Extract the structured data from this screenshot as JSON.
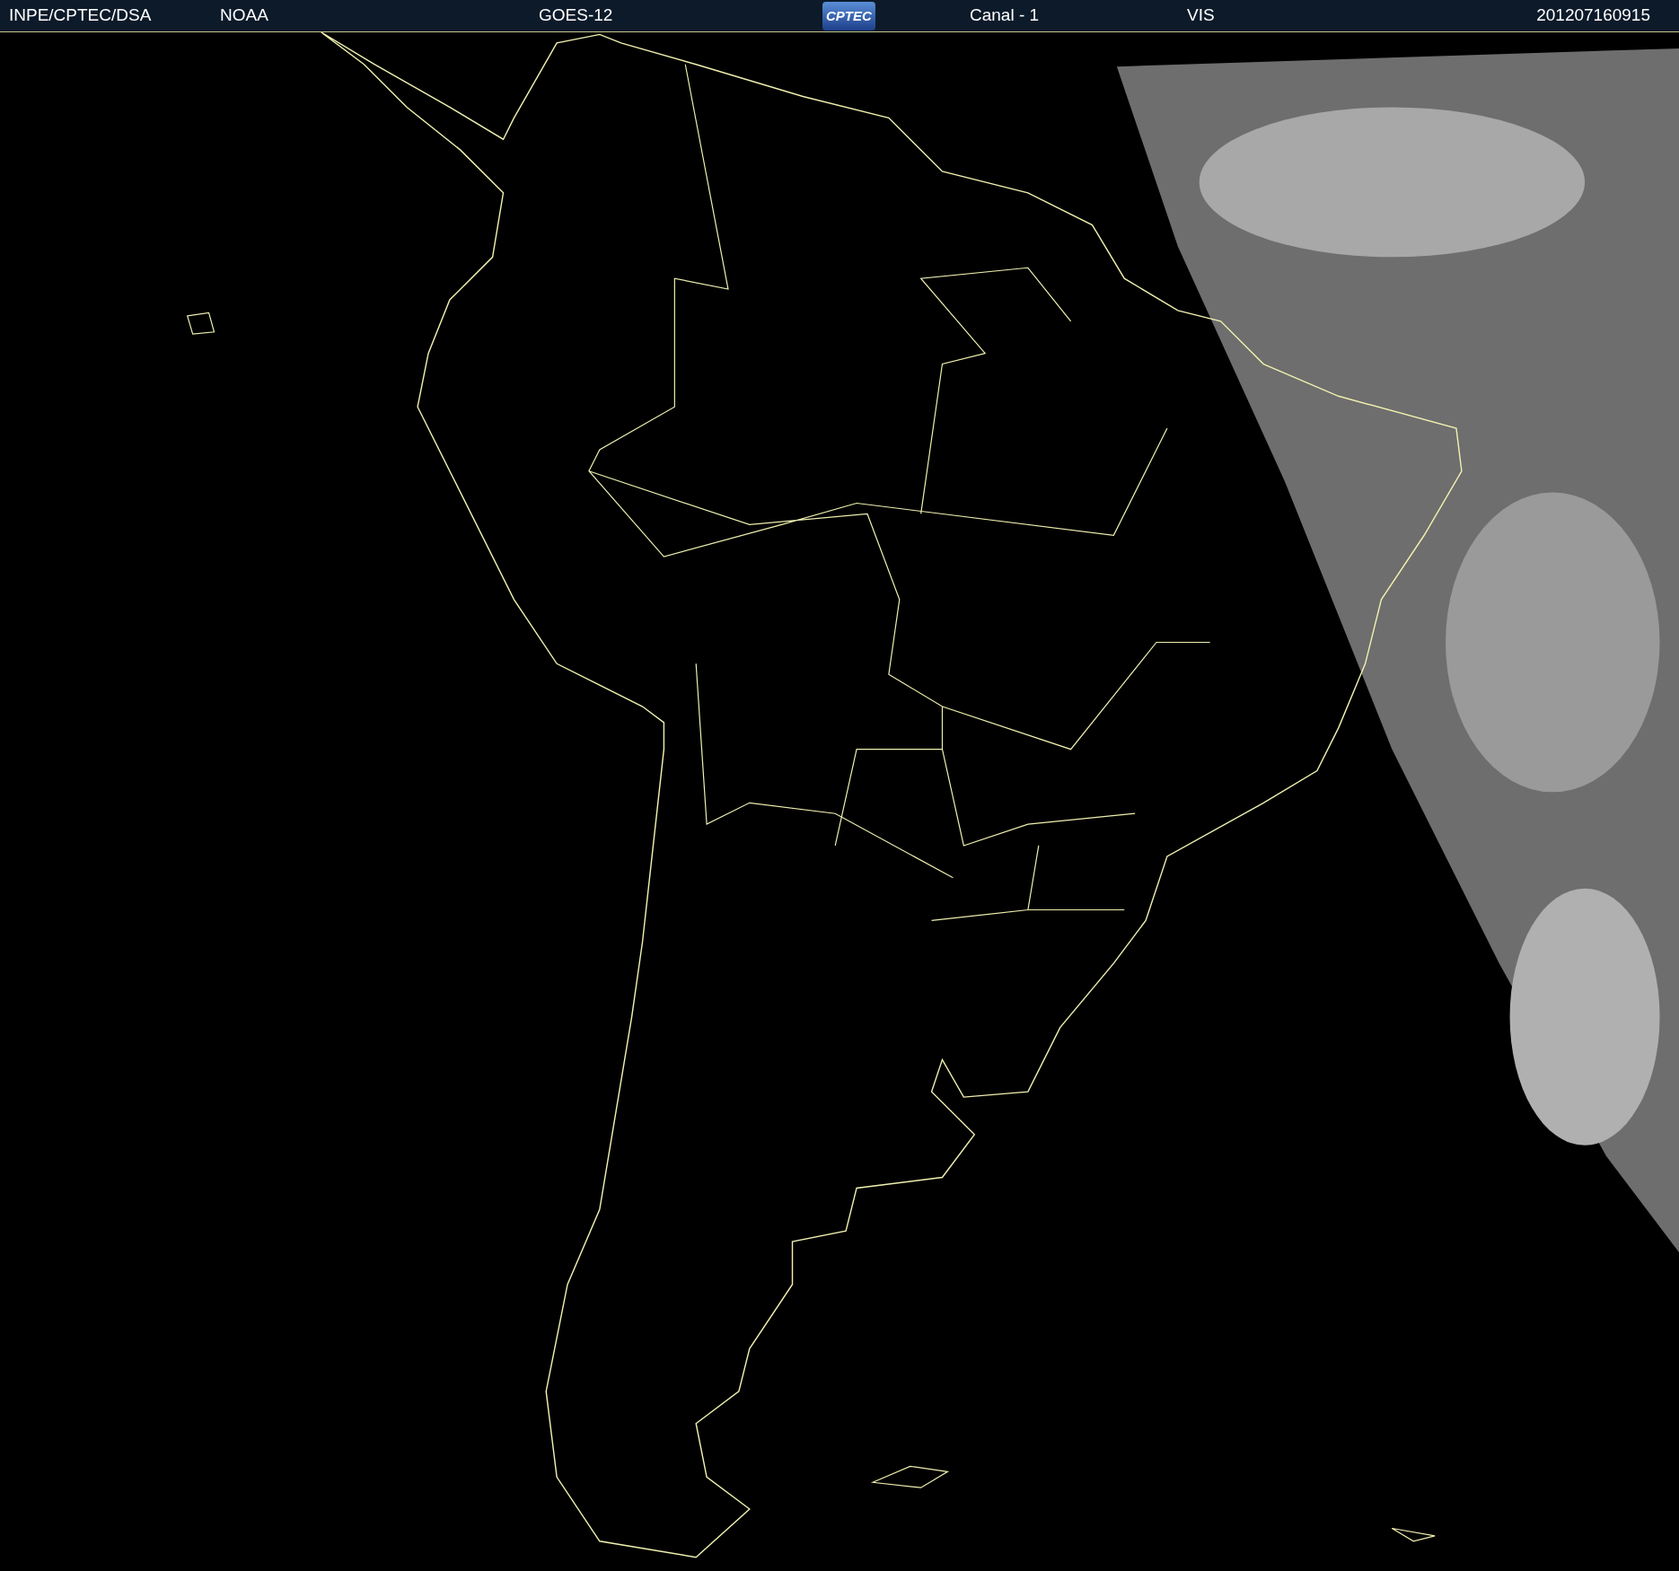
{
  "header": {
    "source": "INPE/CPTEC/DSA",
    "agency": "NOAA",
    "satellite": "GOES-12",
    "logo": "CPTEC",
    "channel": "Canal - 1",
    "band": "VIS",
    "timestamp": "201207160915"
  }
}
